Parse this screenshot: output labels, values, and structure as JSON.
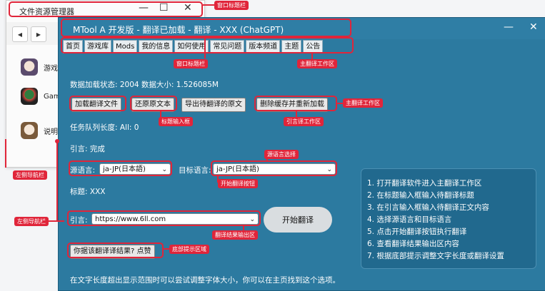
{
  "explorer": {
    "title": "文件资源管理器",
    "controls": {
      "minimize": "—",
      "maximize": "☐",
      "close": "✕"
    },
    "nav": {
      "back": "◀",
      "forward": "▶"
    },
    "items": [
      {
        "label": "游戏",
        "icon": "anime-avatar-icon"
      },
      {
        "label": "Gam",
        "icon": "game-character-icon"
      },
      {
        "label": "说明",
        "icon": "anime-avatar-icon-2"
      }
    ]
  },
  "main": {
    "title": "MTool A 开发版 - 翻译已加载 - 翻译 - XXX (ChatGPT)",
    "controls": {
      "minimize": "—",
      "close": "✕"
    },
    "tabs": [
      "首页",
      "游戏库",
      "Mods",
      "我的信息",
      "如何使用",
      "常见问题",
      "版本频道",
      "主题",
      "公告"
    ],
    "status": "数据加载状态: 2004 数据大小: 1.526085M",
    "buttons": {
      "load": "加载翻译文件",
      "restore": "还原原文本",
      "export": "导出待翻译的原文",
      "clear_reload": "删除缓存并重新加载"
    },
    "queue": "任务队列长度: All: 0",
    "quote_status": "引言: 完成",
    "source_lang_label": "源语言:",
    "source_lang_value": "ja-JP(日本語)",
    "target_lang_label": "目标语言:",
    "target_lang_value": "ja-JP(日本語)",
    "title_field": "标题: XXX",
    "quote_label": "引言:",
    "quote_url": "https://www.6ll.com",
    "start_button": "开始翻译",
    "feedback_button": "你据该翻译译结果? 点赞",
    "footer": "在文字长度超出显示范围时可以尝试调整字体大小，你可以在主页找到这个选项。",
    "steps": [
      "1. 打开翻译软件进入主翻译工作区",
      "2. 在标题输入框输入待翻译标题",
      "3. 在引言输入框输入待翻译正文内容",
      "4. 选择源语言和目标语言",
      "5. 点击开始翻译按钮执行翻译",
      "6. 查看翻译结果输出区内容",
      "7. 根据底部提示调整文字长度或翻译设置"
    ]
  },
  "annotations": {
    "explorer_titlebar": "窗口标题栏",
    "main_titlebar": "窗口标题栏",
    "main_workspace_top": "主翻译工作区",
    "title_input": "标题输入框",
    "main_workspace_right": "主翻译工作区",
    "quote_workspace": "引言译工作区",
    "source_select": "源语言选择",
    "start_button": "开始翻译按钮",
    "left_nav_top": "左侧导航栏",
    "left_nav_bottom": "左侧导航栏",
    "output_area": "翻译结果输出区",
    "bottom_tip": "底部提示区域",
    "color": "#e0253a"
  }
}
